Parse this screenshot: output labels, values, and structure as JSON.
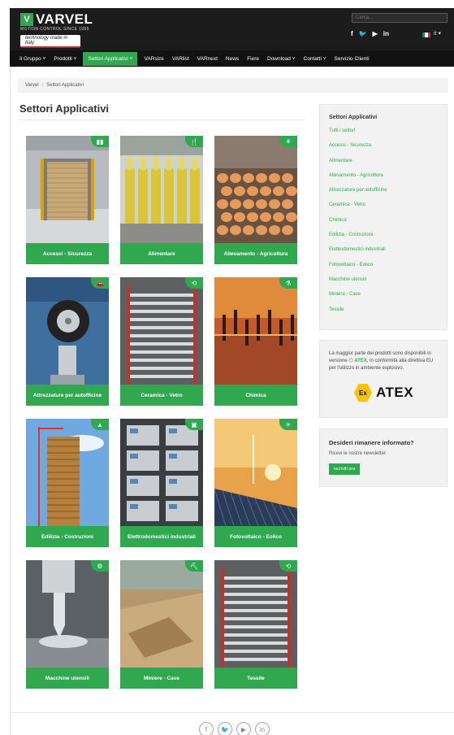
{
  "header": {
    "logo_text": "VARVEL",
    "logo_subtitle": "MOTION CONTROL SINCE 1955",
    "tagline": "technology made in Italy",
    "search_placeholder": "Cerca...",
    "social": [
      {
        "icon": "facebook-icon",
        "glyph": "f"
      },
      {
        "icon": "twitter-icon",
        "glyph": "🐦"
      },
      {
        "icon": "youtube-icon",
        "glyph": "▶"
      },
      {
        "icon": "linkedin-icon",
        "glyph": "in"
      }
    ],
    "lang_caret": "it ▾",
    "flag_colors": [
      "#009246",
      "#ffffff",
      "#ce2b37"
    ]
  },
  "nav": {
    "items": [
      {
        "label": "Il Gruppo ˅"
      },
      {
        "label": "Prodotti ˅"
      },
      {
        "label": "Settori Applicativi ˅",
        "active": true
      },
      {
        "label": "VARsize"
      },
      {
        "label": "VARlist"
      },
      {
        "label": "VARnext"
      },
      {
        "label": "News"
      },
      {
        "label": "Fiere"
      },
      {
        "label": "Download ˅"
      },
      {
        "label": "Contatti ˅"
      },
      {
        "label": "Servizio Clienti"
      }
    ]
  },
  "breadcrumb": {
    "home": "Varvel",
    "separator": "/",
    "current": "Settori Applicativi"
  },
  "page": {
    "title": "Settori Applicativi"
  },
  "cards": [
    {
      "label": "Accessi - Sicurezza",
      "badge": "▮▮",
      "scene": "door"
    },
    {
      "label": "Alimentare",
      "badge": "🍴",
      "scene": "bottles"
    },
    {
      "label": "Allevamento - Agricoltura",
      "badge": "⚘",
      "scene": "eggs"
    },
    {
      "label": "Attrezzature per autofficine",
      "badge": "🚗",
      "scene": "car"
    },
    {
      "label": "Ceramica - Vetro",
      "badge": "⟲",
      "scene": "rollers"
    },
    {
      "label": "Chimica",
      "badge": "⚗",
      "scene": "plant"
    },
    {
      "label": "Edilizia - Costruzioni",
      "badge": "▲",
      "scene": "building"
    },
    {
      "label": "Elettrodomestici industriali",
      "badge": "▣",
      "scene": "ovens"
    },
    {
      "label": "Fotovoltaico - Eolico",
      "badge": "☀",
      "scene": "solar"
    },
    {
      "label": "Macchine utensili",
      "badge": "⚙",
      "scene": "drill"
    },
    {
      "label": "Miniere - Cave",
      "badge": "⛏",
      "scene": "quarry"
    },
    {
      "label": "Tessile",
      "badge": "⟲",
      "scene": "rollers2"
    }
  ],
  "sidebar": {
    "title": "Settori Applicativi",
    "links": [
      "Tutti i settori",
      "Accessi - Sicurezza",
      "Alimentare",
      "Allevamento - Agricoltura",
      "Attrezzature per autofficine",
      "Ceramica - Vetro",
      "Chimica",
      "Edilizia - Costruzioni",
      "Elettrodomestici industriali",
      "Fotovoltaico - Eolico",
      "Macchine utensili",
      "Miniera - Cave",
      "Tessile"
    ]
  },
  "atex": {
    "text_1": "La maggior parte dei prodotti sono disponibili in versione",
    "text_tag": "ATEX",
    "text_2": ", in conformità alla direttiva EU per l'utilizzo in ambiente esplosivo.",
    "logo_symbol": "Ex",
    "logo_word": "ATEX"
  },
  "newsletter": {
    "title": "Desideri rimanere informato?",
    "subtitle": "Ricevi le nostre newsletter.",
    "button": "Iscriviti ora"
  },
  "footer": {
    "social": [
      "f",
      "🐦",
      "▶",
      "in"
    ]
  },
  "colors": {
    "accent": "#2fa84f",
    "header_bg": "#1c1c1c",
    "nav_bg": "#121212"
  }
}
